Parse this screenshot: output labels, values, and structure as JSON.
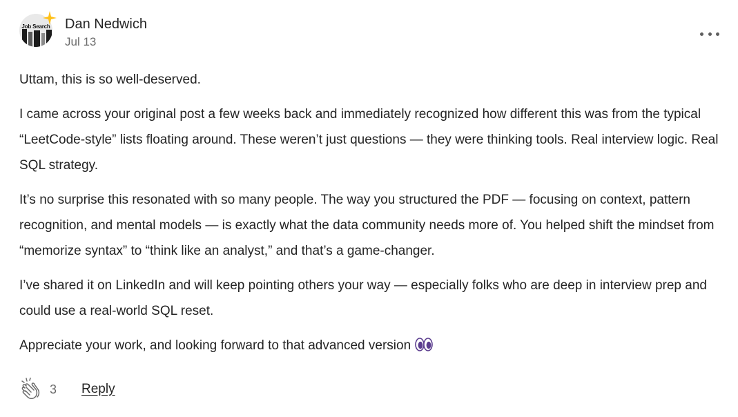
{
  "comment": {
    "author": {
      "name": "Dan Nedwich",
      "avatar_text": "Job Search"
    },
    "date": "Jul 13",
    "paragraphs": [
      "Uttam, this is so well-deserved.",
      "I came across your original post a few weeks back and immediately recognized how different this was from the typical “LeetCode-style” lists floating around. These weren’t just questions — they were thinking tools. Real interview logic. Real SQL strategy.",
      "It’s no surprise this resonated with so many people. The way you structured the PDF — focusing on context, pattern recognition, and mental models — is exactly what the data community needs more of. You helped shift the mindset from “memorize syntax” to “think like an analyst,” and that’s a game-changer.",
      "I’ve shared it on LinkedIn and will keep pointing others your way — especially folks who are deep in interview prep and could use a real-world SQL reset.",
      "Appreciate your work, and looking forward to that advanced version"
    ],
    "trailing_emoji_icon": "eyes-emoji",
    "claps": "3",
    "reply_label": "Reply"
  },
  "colors": {
    "text": "#242424",
    "muted": "#6b6b6b",
    "star": "#ffc017",
    "eyes_purple": "#5b3d8e"
  }
}
